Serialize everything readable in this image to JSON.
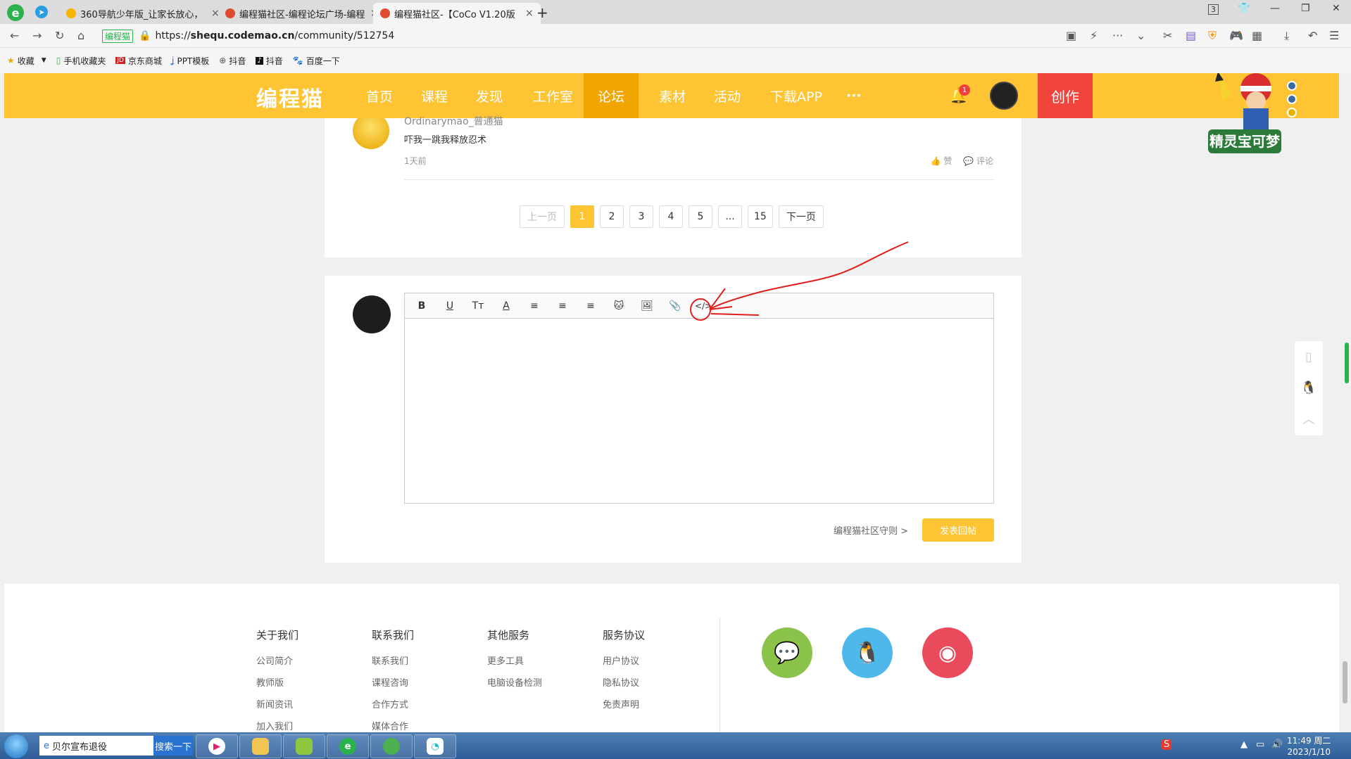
{
  "browser": {
    "tabs": [
      {
        "title": "360导航少年版_让家长放心，",
        "close": "×"
      },
      {
        "title": "编程猫社区-编程论坛广场-编程",
        "close": "×"
      },
      {
        "title": "编程猫社区-【CoCo V1.20版",
        "close": "×"
      }
    ],
    "new_tab": "+",
    "tab_count": "3",
    "url_verified": "编程猫",
    "url_prefix": "https://",
    "url_domain": "shequ.codemao.cn",
    "url_path": "/community/512754",
    "bookmarks": [
      {
        "label": "收藏",
        "icon": "star-icon"
      },
      {
        "label": "手机收藏夹",
        "icon": "phone-icon"
      },
      {
        "label": "京东商城",
        "icon": "jd-icon"
      },
      {
        "label": "PPT模板",
        "icon": "ppt-icon"
      },
      {
        "label": "抖音",
        "icon": "globe-icon"
      },
      {
        "label": "抖音",
        "icon": "tiktok-icon"
      },
      {
        "label": "百度一下",
        "icon": "baidu-icon"
      }
    ]
  },
  "site": {
    "logo": "编程猫",
    "nav": [
      "首页",
      "课程",
      "发现",
      "工作室",
      "论坛",
      "素材",
      "活动",
      "下载APP",
      "···"
    ],
    "active_nav": "论坛",
    "notif_count": "1",
    "create_label": "创作"
  },
  "comment": {
    "username": "Ordinarymao_普通猫",
    "text": "吓我一跳我释放忍术",
    "time": "1天前",
    "like_label": "赞",
    "reply_label": "评论"
  },
  "pagination": {
    "prev": "上一页",
    "pages": [
      "1",
      "2",
      "3",
      "4",
      "5",
      "...",
      "15"
    ],
    "next": "下一页",
    "current": "1"
  },
  "editor": {
    "toolbar": [
      {
        "glyph": "B",
        "name": "bold-icon"
      },
      {
        "glyph": "U",
        "name": "underline-icon"
      },
      {
        "glyph": "Tт",
        "name": "font-size-icon"
      },
      {
        "glyph": "A",
        "name": "font-color-icon"
      },
      {
        "glyph": "≡",
        "name": "align-left-icon"
      },
      {
        "glyph": "≡",
        "name": "align-center-icon"
      },
      {
        "glyph": "≡",
        "name": "align-right-icon"
      },
      {
        "glyph": "🐱",
        "name": "emoji-icon"
      },
      {
        "glyph": "🖼",
        "name": "image-icon"
      },
      {
        "glyph": "📎",
        "name": "attachment-icon"
      },
      {
        "glyph": "</>",
        "name": "code-icon"
      }
    ],
    "rules_link": "编程猫社区守则 >",
    "submit_label": "发表回帖"
  },
  "footer": {
    "columns": [
      {
        "title": "关于我们",
        "links": [
          "公司简介",
          "教师版",
          "新闻资讯",
          "加入我们"
        ]
      },
      {
        "title": "联系我们",
        "links": [
          "联系我们",
          "课程咨询",
          "合作方式",
          "媒体合作"
        ]
      },
      {
        "title": "其他服务",
        "links": [
          "更多工具",
          "电脑设备检测"
        ]
      },
      {
        "title": "服务协议",
        "links": [
          "用户协议",
          "隐私协议",
          "免责声明"
        ]
      }
    ],
    "social": [
      {
        "name": "wechat-icon",
        "color": "#8bc34a"
      },
      {
        "name": "qq-icon",
        "color": "#4fb8ea"
      },
      {
        "name": "weibo-icon",
        "color": "#ea4b5c"
      }
    ]
  },
  "taskbar": {
    "search_text": "贝尔宣布退役",
    "search_button": "搜索一下",
    "time": "11:49 周二",
    "date": "2023/1/10"
  },
  "colors": {
    "brand": "#fec433",
    "nav_active": "#f0a500",
    "create": "#f0443c",
    "annotation": "#e0201c"
  }
}
